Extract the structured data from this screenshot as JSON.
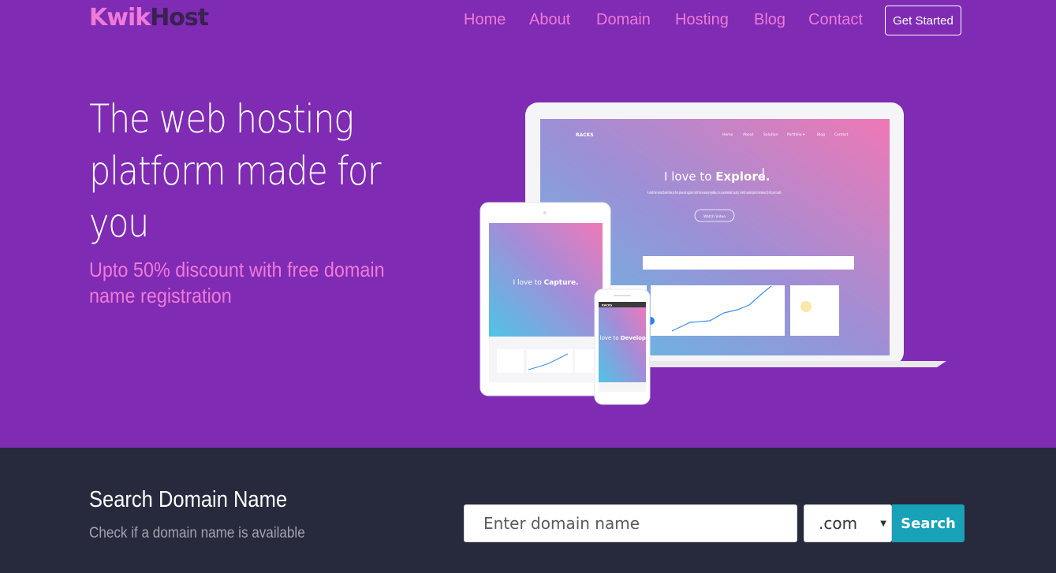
{
  "brand": {
    "part1": "Kwik",
    "part2": "Host"
  },
  "nav": {
    "items": [
      {
        "label": "Home"
      },
      {
        "label": "About"
      },
      {
        "label": "Domain"
      },
      {
        "label": "Hosting"
      },
      {
        "label": "Blog"
      },
      {
        "label": "Contact"
      }
    ],
    "cta_label": "Get Started"
  },
  "hero": {
    "headline": "The web hosting platform made for you",
    "subheadline": "Upto 50% discount with free domain name registration"
  },
  "mockup": {
    "laptop": {
      "brand": "RACKS",
      "nav": [
        "Home",
        "About",
        "Solution",
        "Portfolio ▾",
        "Blog",
        "Contact"
      ],
      "tagline_prefix": "I love to ",
      "tagline_word": "Explore.",
      "body": "A small river named Duden flows by their place and supplies it with the necessary regelialia. It is a paradisematic country, in which roasted parts of sentences fly into your mouth.",
      "button": "Watch Video"
    },
    "tablet": {
      "tagline_prefix": "I love to ",
      "tagline_word": "Capture."
    },
    "phone": {
      "brand": "RACKS",
      "tagline_prefix": "I love to ",
      "tagline_word": "Develop."
    }
  },
  "search": {
    "title": "Search Domain Name",
    "subtitle": "Check if a domain name is available",
    "placeholder": "Enter domain name",
    "tld_selected": ".com",
    "button_label": "Search"
  },
  "colors": {
    "hero_bg": "#7f2bb4",
    "accent_pink": "#f07ad7",
    "search_bg": "#272a3d",
    "search_button": "#18a2b8"
  }
}
